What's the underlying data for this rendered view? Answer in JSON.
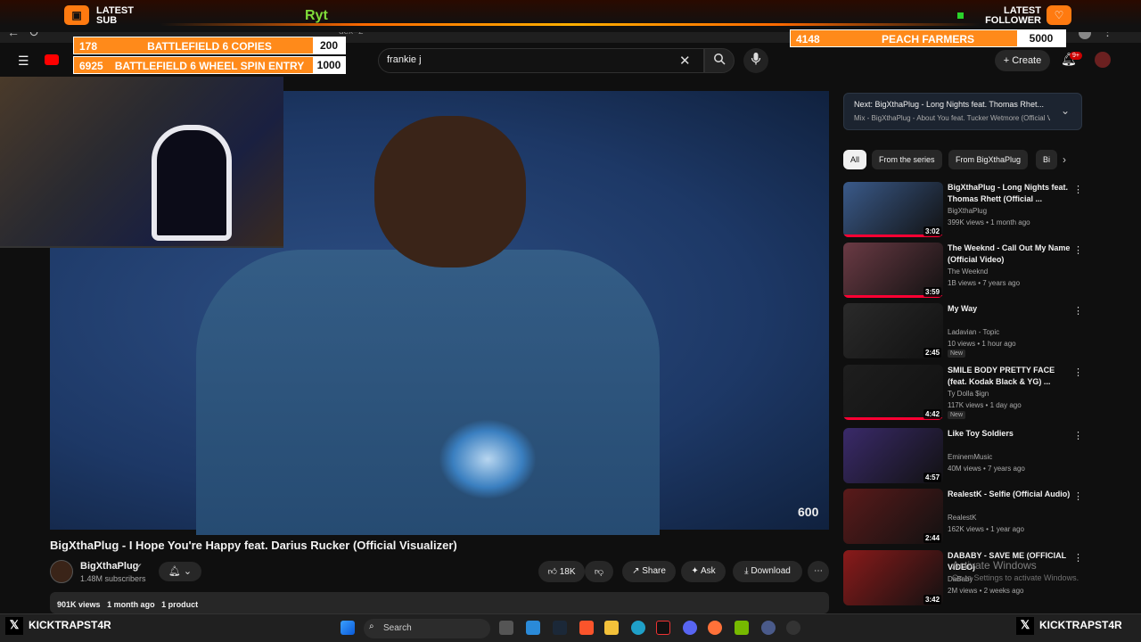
{
  "overlay": {
    "latest_sub_label": "LATEST\nSUB",
    "latest_sub_name": "Ryt",
    "latest_follower_label": "LATEST\nFOLLOWER",
    "goals_left": [
      {
        "count": "178",
        "title": "BATTLEFIELD 6 COPIES",
        "target": "200"
      },
      {
        "count": "6925",
        "title": "BATTLEFIELD 6 WHEEL SPIN ENTRY",
        "target": "1000"
      }
    ],
    "goal_right": {
      "count": "4148",
      "title": "PEACH FARMERS",
      "target": "5000"
    },
    "kick_left": "KICKTRAPST4R",
    "kick_right": "KICKTRAPST4R"
  },
  "browser": {
    "url_fragment": "dex=2"
  },
  "header": {
    "search_value": "frankie j",
    "create_label": "Create",
    "notification_badge": "9+"
  },
  "video": {
    "title": "BigXthaPlug - I Hope You're Happy feat. Darius Rucker (Official Visualizer)",
    "watermark": "600",
    "channel": "BigXthaPlug",
    "subscribers": "1.48M subscribers",
    "likes": "18K",
    "share_label": "Share",
    "ask_label": "Ask",
    "download_label": "Download",
    "views": "901K views",
    "age": "1 month ago",
    "product": "1 product"
  },
  "next": {
    "title": "Next: BigXthaPlug - Long Nights feat. Thomas Rhet...",
    "subtitle": "Mix - BigXthaPlug - About You feat. Tucker Wetmore (Official V"
  },
  "chips": [
    "All",
    "From the series",
    "From BigXthaPlug",
    "Bi"
  ],
  "recommendations": [
    {
      "title": "BigXthaPlug - Long Nights feat. Thomas Rhett (Official ...",
      "channel": "BigXthaPlug",
      "meta": "399K views • 1 month ago",
      "duration": "3:02",
      "new": "",
      "progress": 1.0,
      "color": "#3a5a8a"
    },
    {
      "title": "The Weeknd - Call Out My Name (Official Video)",
      "channel": "The Weeknd",
      "meta": "1B views • 7 years ago",
      "duration": "3:59",
      "new": "",
      "progress": 1.0,
      "color": "#6a3a44"
    },
    {
      "title": "My Way",
      "channel": "Ladavian - Topic",
      "meta": "10 views • 1 hour ago",
      "duration": "2:45",
      "new": "New",
      "progress": 0,
      "color": "#2a2a2a"
    },
    {
      "title": "SMILE BODY PRETTY FACE (feat. Kodak Black & YG) ...",
      "channel": "Ty Dolla $ign",
      "meta": "117K views • 1 day ago",
      "duration": "4:42",
      "new": "New",
      "progress": 1.0,
      "color": "#1e1e1e"
    },
    {
      "title": "Like Toy Soldiers",
      "channel": "EminemMusic",
      "meta": "40M views • 7 years ago",
      "duration": "4:57",
      "new": "",
      "progress": 0,
      "color": "#3a2a6a"
    },
    {
      "title": "RealestK - Selfie (Official Audio)",
      "channel": "RealestK",
      "meta": "162K views • 1 year ago",
      "duration": "2:44",
      "new": "",
      "progress": 0,
      "color": "#5a1a1a"
    },
    {
      "title": "DABABY - SAVE ME (OFFICIAL VIDEO)",
      "channel": "DaBaby",
      "meta": "2M views • 2 weeks ago",
      "duration": "3:42",
      "new": "",
      "progress": 0,
      "color": "#8a1a1a"
    }
  ],
  "windows": {
    "activate_title": "Activate Windows",
    "activate_sub": "Go to Settings to activate Windows.",
    "search_placeholder": "Search"
  },
  "colors": {
    "accent": "#ff0033",
    "overlay_orange": "#ff8a1a"
  }
}
